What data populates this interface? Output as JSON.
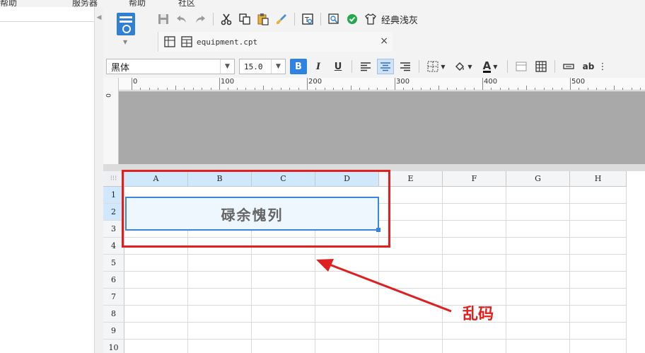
{
  "menu": {
    "items": [
      "帮助",
      "服务器",
      "帮助",
      "社区"
    ]
  },
  "quick_toolbar": {
    "theme_label": "经典浅灰"
  },
  "tab": {
    "title": "equipment.cpt",
    "close": "×"
  },
  "format_toolbar": {
    "font_family": "黑体",
    "font_size": "15.0",
    "bold": "B",
    "italic": "I",
    "underline": "U",
    "text_color_letter": "A",
    "ab_label": "ab"
  },
  "ruler": {
    "labels": [
      "0",
      "100",
      "200",
      "300",
      "400",
      "500"
    ],
    "vertical_label": "0"
  },
  "sheet": {
    "corner": "⁝⁝⁝",
    "columns": [
      "A",
      "B",
      "C",
      "D",
      "E",
      "F",
      "G",
      "H"
    ],
    "rows": [
      "1",
      "2",
      "3",
      "4",
      "5",
      "6",
      "7",
      "8",
      "9",
      "10"
    ],
    "merged_cell_text": "碌余愧列"
  },
  "annotation": {
    "label": "乱码",
    "color": "#e02020"
  },
  "colors": {
    "accent": "#2f82e0",
    "selection": "#cfe8fb",
    "annotation": "#e02020"
  }
}
